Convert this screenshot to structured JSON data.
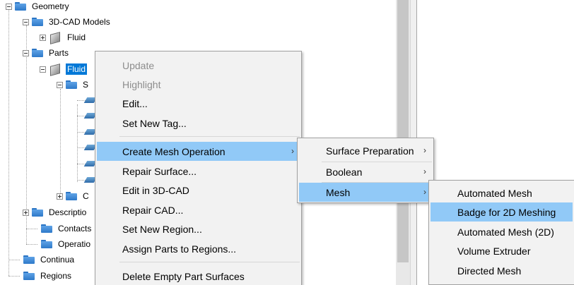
{
  "tree": {
    "geometry": "Geometry",
    "cad_models": "3D-CAD Models",
    "fluid_cad": "Fluid",
    "parts": "Parts",
    "fluid_part": "Fluid",
    "surfaces_partial": "S",
    "contacts_partial": "C",
    "descriptions": "Descriptio",
    "contacts": "Contacts",
    "operations": "Operatio",
    "continua": "Continua",
    "regions": "Regions"
  },
  "context_menu": {
    "items": [
      {
        "label": "Update",
        "enabled": false
      },
      {
        "label": "Highlight",
        "enabled": false
      },
      {
        "label": "Edit...",
        "enabled": true
      },
      {
        "label": "Set New Tag...",
        "enabled": true
      },
      {
        "label": "Create Mesh Operation",
        "enabled": true,
        "submenu": true,
        "highlighted": true
      },
      {
        "label": "Repair Surface...",
        "enabled": true
      },
      {
        "label": "Edit in 3D-CAD",
        "enabled": true
      },
      {
        "label": "Repair CAD...",
        "enabled": true
      },
      {
        "label": "Set New Region...",
        "enabled": true
      },
      {
        "label": "Assign Parts to Regions...",
        "enabled": true
      },
      {
        "label": "Delete Empty Part Surfaces",
        "enabled": true
      }
    ]
  },
  "mesh_operation_menu": {
    "items": [
      {
        "label": "Surface Preparation",
        "submenu": true
      },
      {
        "label": "Boolean",
        "submenu": true
      },
      {
        "label": "Mesh",
        "submenu": true,
        "highlighted": true
      }
    ]
  },
  "mesh_menu": {
    "items": [
      {
        "label": "Automated Mesh"
      },
      {
        "label": "Badge for 2D Meshing",
        "highlighted": true
      },
      {
        "label": "Automated Mesh (2D)"
      },
      {
        "label": "Volume Extruder"
      },
      {
        "label": "Directed Mesh"
      }
    ]
  },
  "arrow_glyph": "›",
  "colors": {
    "selection": "#0078d7",
    "menu_highlight": "#91c9f7",
    "menu_background": "#f2f2f2",
    "folder": "#3a86d4"
  }
}
